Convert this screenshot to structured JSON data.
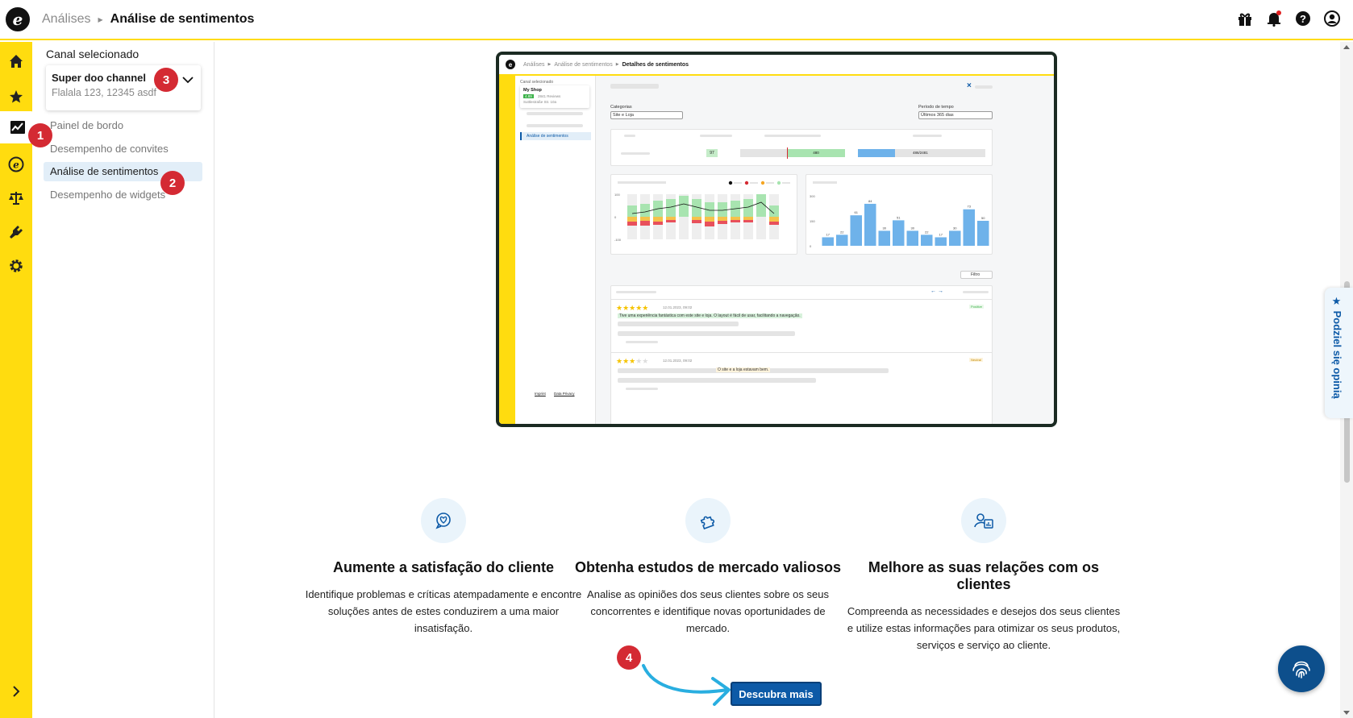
{
  "colors": {
    "brand_yellow": "#ffdc0f",
    "primary_blue": "#0d5aa7",
    "badge_red": "#d42a33",
    "active_nav_bg": "#e2eef8"
  },
  "header": {
    "breadcrumb_parent": "Análises",
    "breadcrumb_current": "Análise de sentimentos",
    "icons": [
      "gift-icon",
      "bell-icon",
      "help-icon",
      "user-icon"
    ]
  },
  "rail": {
    "items": [
      "home-icon",
      "star-icon",
      "analytics-icon",
      "trusted-icon",
      "scale-icon",
      "plug-icon",
      "gear-icon"
    ],
    "expand": "chevron-right-icon"
  },
  "subnav": {
    "channel_label": "Canal selecionado",
    "channel_name": "Super doo channel",
    "channel_address": "Flalala 123, 12345 asdf",
    "items": [
      {
        "label": "Painel de bordo"
      },
      {
        "label": "Desempenho de convites"
      },
      {
        "label": "Análise de sentimentos"
      },
      {
        "label": "Desempenho de widgets"
      }
    ]
  },
  "badges": [
    "1",
    "2",
    "3",
    "4"
  ],
  "preview": {
    "breadcrumb_a": "Análises",
    "breadcrumb_b": "Análise de sentimentos",
    "breadcrumb_c": "Detalhes de sentimentos",
    "channel_label": "Canal selecionado",
    "shop_name": "My Shop",
    "shop_rating": "4.89",
    "shop_reviews": "2841 Reviews",
    "shop_address": "Suttlestraße Str. 10a",
    "nav_active": "Análise de sentimentos",
    "categories_label": "Categorias",
    "categories_value": "Site e Loja",
    "period_label": "Período de tempo",
    "period_value": "Últimos 365 dias",
    "score": "97",
    "positive_count": "480",
    "total": "486/2481",
    "filter": "Filtro",
    "review1_date": "12.01.2023, 09:02",
    "review1_text": "Tive uma experiência fantástica com este site e loja. O layout é fácil de usar, facilitando a navegação.",
    "review1_tag": "Positive",
    "review2_date": "12.01.2023, 09:02",
    "review2_text": "O site e a loja estavam bem.",
    "review2_tag": "Neutral",
    "footer_imprint": "Imprint",
    "footer_privacy": "Data Privacy",
    "line_y_ticks": [
      "100",
      "0",
      "-100"
    ],
    "bar_y_ticks": [
      "300",
      "150",
      "0"
    ]
  },
  "chart_data": {
    "type": "bar",
    "values": [
      17,
      22,
      61,
      84,
      30,
      51,
      30,
      22,
      17,
      30,
      73,
      50
    ],
    "ylim": [
      0,
      100
    ]
  },
  "features": [
    {
      "icon": "heart-chat-icon",
      "title": "Aumente a satisfação do cliente",
      "desc": "Identifique problemas e críticas atempadamente e encontre soluções antes de estes conduzirem a uma maior insatisfação."
    },
    {
      "icon": "puzzle-icon",
      "title": "Obtenha estudos de mercado valiosos",
      "desc": "Analise as opiniões dos seus clientes sobre os seus concorrentes e identifique novas oportunidades de mercado."
    },
    {
      "icon": "user-chart-icon",
      "title": "Melhore as suas relações com os clientes",
      "desc": "Compreenda as necessidades e desejos dos seus clientes e utilize estas informações para otimizar os seus produtos, serviços e serviço ao cliente."
    }
  ],
  "cta": {
    "label": "Descubra mais"
  },
  "feedback": {
    "label": "Podziel się opinią"
  }
}
